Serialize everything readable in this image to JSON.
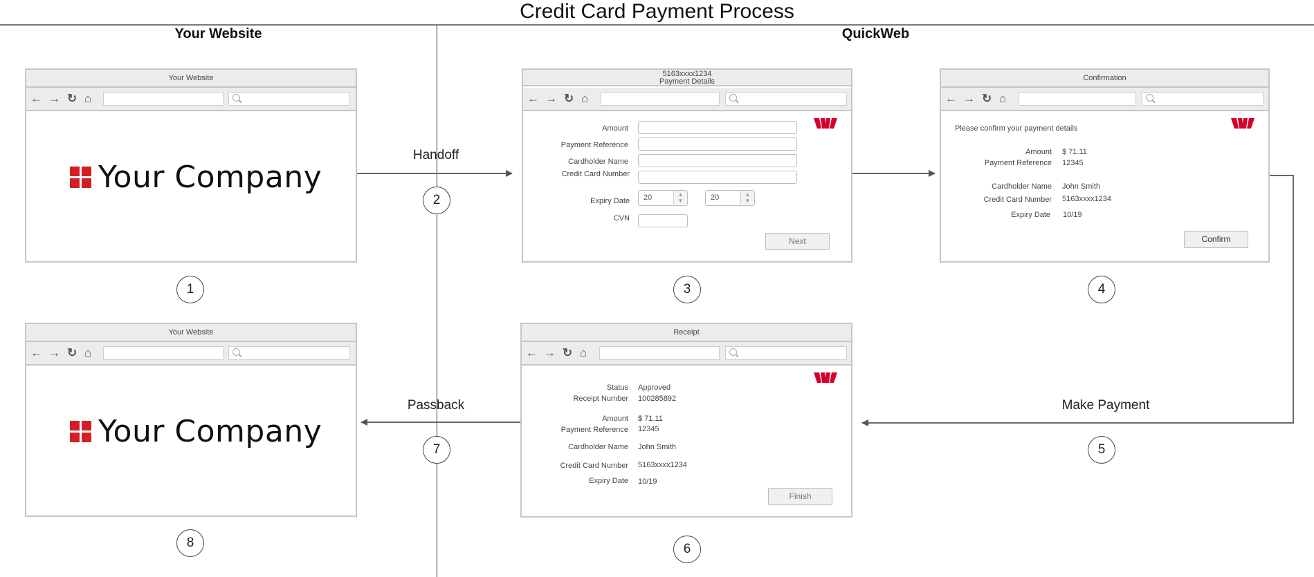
{
  "title": "Credit Card Payment Process",
  "lanes": {
    "left": "Your Website",
    "right": "QuickWeb"
  },
  "colors": {
    "brand_red": "#d21f26",
    "westpac_red": "#d5002b",
    "connector": "#555555",
    "window_border": "#c6c6c6"
  },
  "company_logo_text": "Your Company",
  "nav_icons": [
    "arrow-left-icon",
    "arrow-right-icon",
    "refresh-icon",
    "home-icon"
  ],
  "connectors": {
    "handoff": "Handoff",
    "make_payment": "Make Payment",
    "passback": "Passback"
  },
  "steps": [
    "1",
    "2",
    "3",
    "4",
    "5",
    "6",
    "7",
    "8"
  ],
  "screens": {
    "website_start": {
      "title": "Your Website"
    },
    "payment_details": {
      "title_line1": "5163xxxx1234",
      "title_line2": "Payment Details",
      "labels": {
        "amount": "Amount",
        "payment_reference": "Payment Reference",
        "cardholder_name": "Cardholder Name",
        "credit_card_number": "Credit Card Number",
        "expiry_date": "Expiry Date",
        "cvn": "CVN"
      },
      "expiry_month": "20",
      "expiry_year": "20",
      "next_button": "Next"
    },
    "confirmation": {
      "title": "Confirmation",
      "intro": "Please confirm your payment details",
      "rows": [
        {
          "label": "Amount",
          "value": "$ 71.11"
        },
        {
          "label": "Payment Reference",
          "value": "12345"
        },
        {
          "label": "Cardholder Name",
          "value": "John Smith"
        },
        {
          "label": "Credit Card Number",
          "value": "5163xxxx1234"
        },
        {
          "label": "Expiry Date",
          "value": "10/19"
        }
      ],
      "confirm_button": "Confirm"
    },
    "receipt": {
      "title": "Receipt",
      "rows": [
        {
          "label": "Status",
          "value": "Approved"
        },
        {
          "label": "Receipt Number",
          "value": "100285892"
        },
        {
          "label": "Amount",
          "value": "$ 71.11"
        },
        {
          "label": "Payment Reference",
          "value": "12345"
        },
        {
          "label": "Cardholder Name",
          "value": "John Smith"
        },
        {
          "label": "Credit Card Number",
          "value": "5163xxxx1234"
        },
        {
          "label": "Expiry Date",
          "value": "10/19"
        }
      ],
      "finish_button": "Finish"
    },
    "website_end": {
      "title": "Your Website"
    }
  }
}
